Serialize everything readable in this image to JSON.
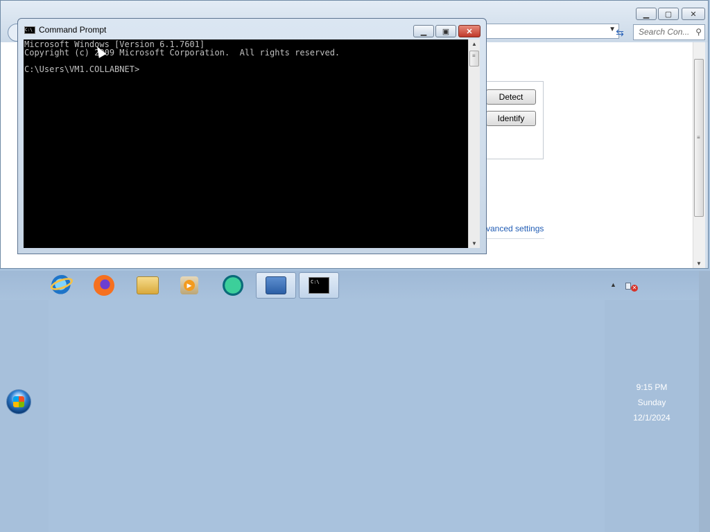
{
  "control_panel": {
    "search_placeholder": "Search Con...",
    "buttons": {
      "detect": "Detect",
      "identify": "Identify"
    },
    "advanced_link": "vanced settings"
  },
  "cmd": {
    "title": "Command Prompt",
    "icon_text": "C:\\",
    "lines": [
      "Microsoft Windows [Version 6.1.7601]",
      "Copyright (c) 2009 Microsoft Corporation.  All rights reserved.",
      "C:\\Users\\VM1.COLLABNET>"
    ]
  },
  "taskbar": {
    "items": [
      {
        "name": "Internet Explorer",
        "icon": "internet-explorer-icon"
      },
      {
        "name": "Firefox",
        "icon": "firefox-icon"
      },
      {
        "name": "Windows Explorer",
        "icon": "folder-icon"
      },
      {
        "name": "Windows Media Player",
        "icon": "media-player-icon"
      },
      {
        "name": "App",
        "icon": "app-icon"
      },
      {
        "name": "Control Panel",
        "icon": "control-panel-icon",
        "active": true
      },
      {
        "name": "Command Prompt",
        "icon": "command-prompt-icon",
        "active": true
      }
    ]
  },
  "tray": {
    "time": "9:15 PM",
    "day": "Sunday",
    "date": "12/1/2024"
  },
  "colors": {
    "desktop": "#a9c2dd",
    "console_bg": "#000000",
    "console_text": "#c0c0c0",
    "link": "#1f5bb4"
  }
}
